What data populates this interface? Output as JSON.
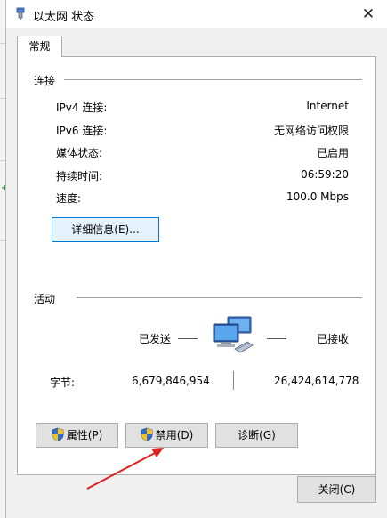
{
  "window": {
    "title": "以太网 状态"
  },
  "tabs": [
    {
      "label": "常规"
    }
  ],
  "connection": {
    "group_title": "连接",
    "rows": [
      {
        "label": "IPv4 连接:",
        "value": "Internet"
      },
      {
        "label": "IPv6 连接:",
        "value": "无网络访问权限"
      },
      {
        "label": "媒体状态:",
        "value": "已启用"
      },
      {
        "label": "持续时间:",
        "value": "06:59:20"
      },
      {
        "label": "速度:",
        "value": "100.0 Mbps"
      }
    ],
    "details_button": "详细信息(E)..."
  },
  "activity": {
    "group_title": "活动",
    "sent_label": "已发送",
    "received_label": "已接收",
    "bytes_label": "字节:",
    "bytes_sent": "6,679,846,954",
    "bytes_received": "26,424,614,778"
  },
  "buttons": {
    "properties": "属性(P)",
    "disable": "禁用(D)",
    "diagnose": "诊断(G)",
    "close": "关闭(C)"
  },
  "colors": {
    "accent": "#0078d7",
    "annotation_arrow": "#e02020",
    "shield_blue": "#2f6fd0",
    "shield_yellow": "#f4c21b"
  },
  "icons": {
    "title": "network-adapter-icon",
    "activity": "network-computers-icon",
    "shield": "uac-shield-icon"
  }
}
